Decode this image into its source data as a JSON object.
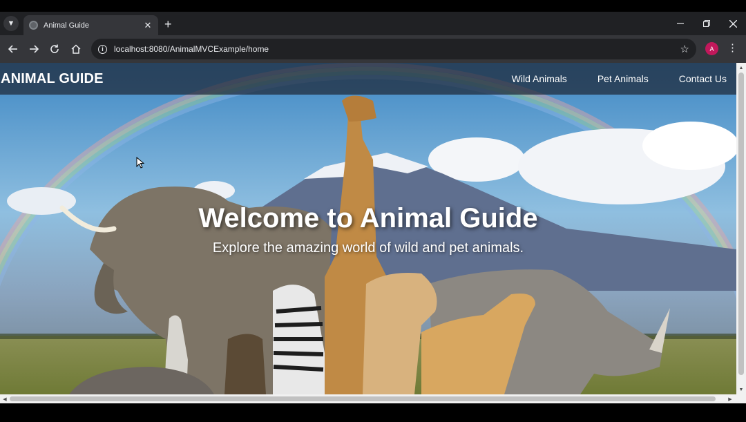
{
  "browser": {
    "tab_title": "Animal Guide",
    "url": "localhost:8080/AnimalMVCExample/home",
    "profile_initial": "A"
  },
  "site": {
    "brand": "ANIMAL GUIDE",
    "nav": [
      "Wild Animals",
      "Pet Animals",
      "Contact Us"
    ]
  },
  "hero": {
    "title": "Welcome to Animal Guide",
    "subtitle": "Explore the amazing world of wild and pet animals."
  }
}
